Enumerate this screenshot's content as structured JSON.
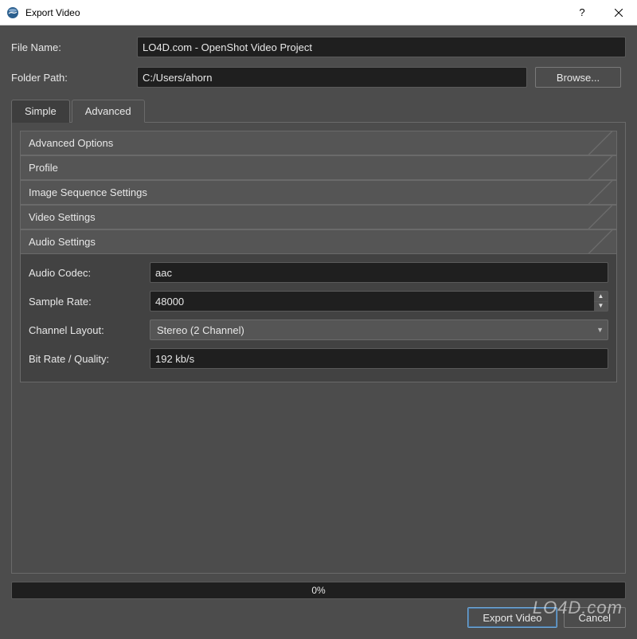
{
  "window": {
    "title": "Export Video"
  },
  "form": {
    "file_name_label": "File Name:",
    "file_name_value": "LO4D.com - OpenShot Video Project",
    "folder_path_label": "Folder Path:",
    "folder_path_value": "C:/Users/ahorn",
    "browse_label": "Browse..."
  },
  "tabs": {
    "simple": "Simple",
    "advanced": "Advanced"
  },
  "sections": {
    "advanced_options": "Advanced Options",
    "profile": "Profile",
    "image_sequence": "Image Sequence Settings",
    "video_settings": "Video Settings",
    "audio_settings": "Audio Settings"
  },
  "audio": {
    "codec_label": "Audio Codec:",
    "codec_value": "aac",
    "sample_rate_label": "Sample Rate:",
    "sample_rate_value": "48000",
    "channel_layout_label": "Channel Layout:",
    "channel_layout_value": "Stereo (2 Channel)",
    "bit_rate_label": "Bit Rate / Quality:",
    "bit_rate_value": "192 kb/s"
  },
  "progress": {
    "text": "0%"
  },
  "buttons": {
    "export": "Export Video",
    "cancel": "Cancel"
  },
  "watermark": "LO4D.com"
}
